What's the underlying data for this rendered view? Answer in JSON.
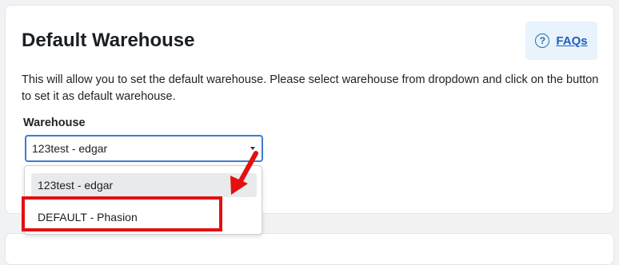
{
  "page": {
    "title": "Default Warehouse",
    "description": "This will allow you to set the default warehouse. Please select warehouse from dropdown and click on the button to set it as default warehouse.",
    "faq_label": "FAQs"
  },
  "form": {
    "field_label": "Warehouse",
    "selected_value": "123test - edgar",
    "options": [
      "123test - edgar",
      "DEFAULT - Phasion"
    ]
  },
  "annotation": {
    "highlight_color": "#e40f0f"
  }
}
